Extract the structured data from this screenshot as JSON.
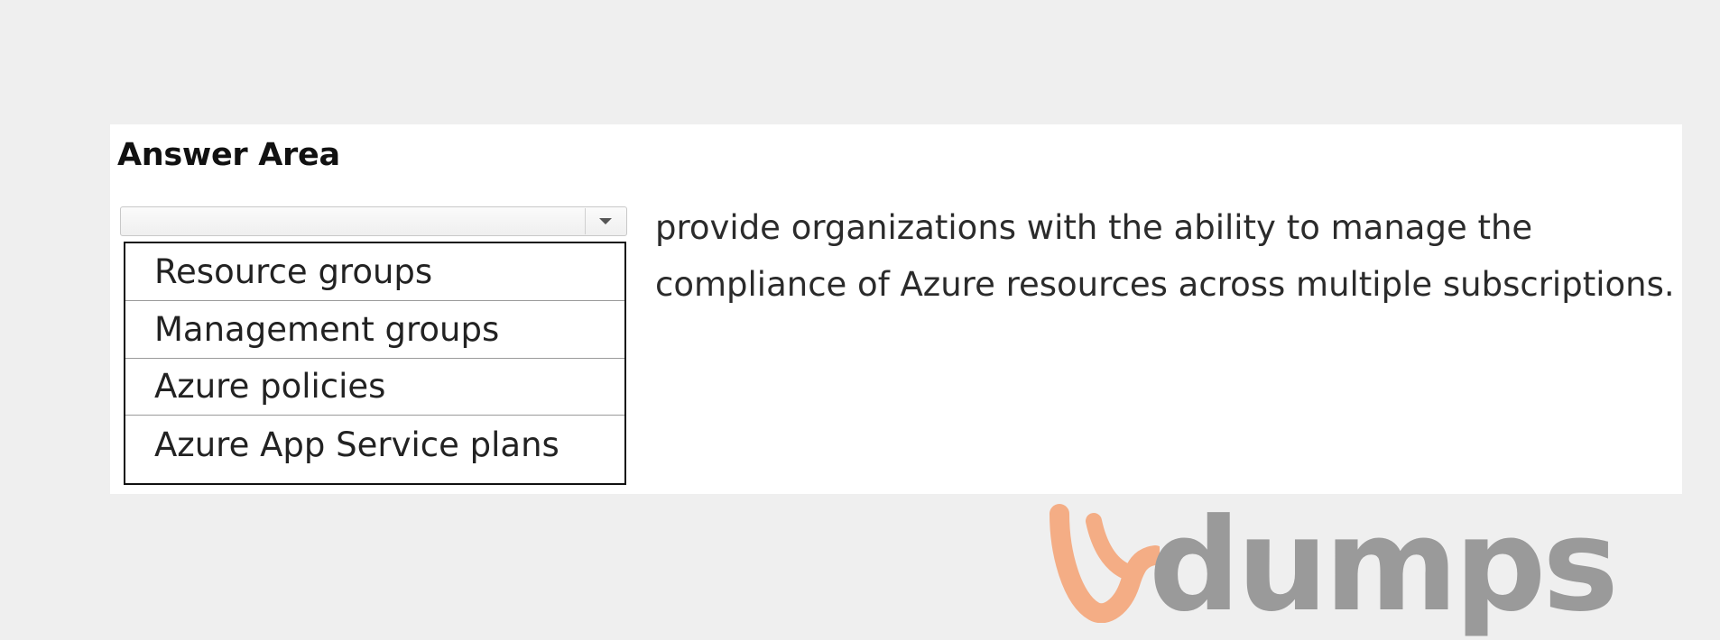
{
  "answer_area": {
    "title": "Answer Area",
    "dropdown": {
      "selected_value": "",
      "options": [
        "Resource groups",
        "Management groups",
        "Azure policies",
        "Azure App Service plans"
      ]
    },
    "statement_lines": [
      "provide organizations with the ability to manage the",
      "compliance of Azure resources across multiple subscriptions."
    ]
  },
  "watermark": {
    "text": "dumps",
    "logo_letter": "V",
    "logo_color": "#f4ad85",
    "text_color": "#9a9a9a"
  },
  "colors": {
    "page_background": "#efefef",
    "panel_background": "#ffffff"
  }
}
